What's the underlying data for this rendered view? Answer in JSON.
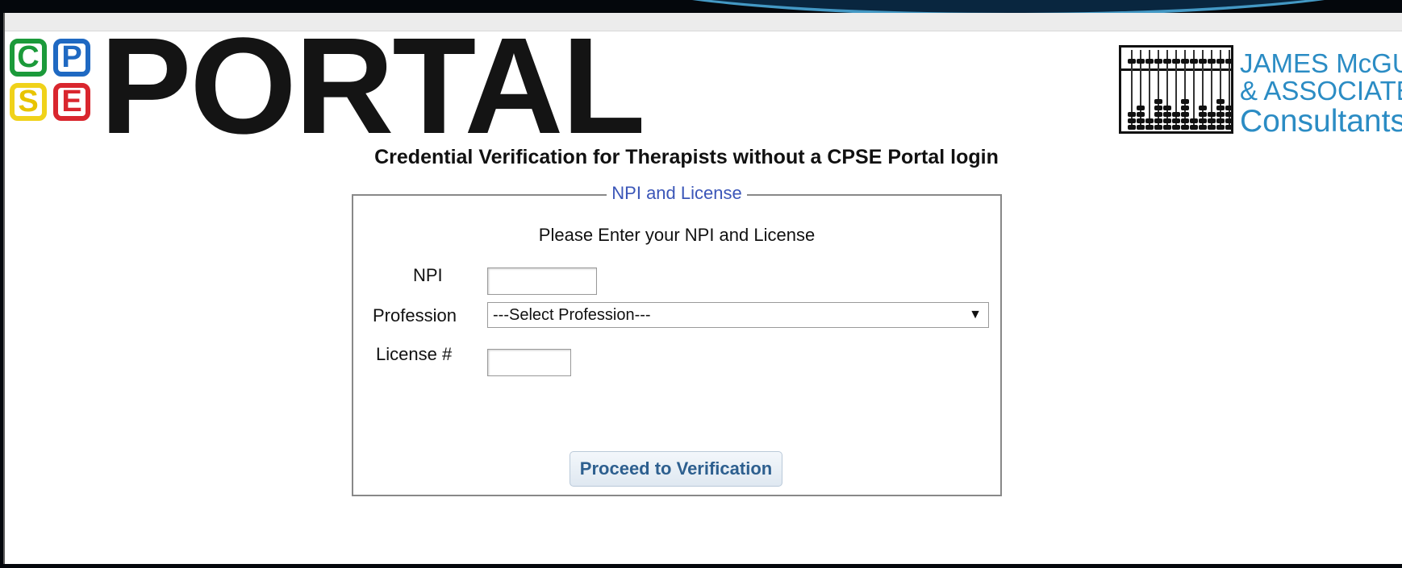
{
  "logo": {
    "letters": [
      "C",
      "P",
      "S",
      "E"
    ],
    "colors": {
      "C": "#1b9a3a",
      "P": "#1f69c2",
      "S": "#e8c400",
      "E": "#d9262e"
    },
    "portal": "PORTAL"
  },
  "company": {
    "line1": "JAMES McGUI",
    "line2": "& ASSOCIATE",
    "line3": "Consultants",
    "color": "#2b8cc4",
    "icon": "abacus-icon"
  },
  "page": {
    "heading": "Credential Verification for Therapists without a CPSE Portal login"
  },
  "form": {
    "legend": "NPI and License",
    "instructions": "Please Enter your NPI and License",
    "npi_label": "NPI",
    "npi_value": "",
    "profession_label": "Profession",
    "profession_selected": "---Select Profession---",
    "license_label": "License #",
    "license_value": "",
    "submit_label": "Proceed to Verification"
  }
}
